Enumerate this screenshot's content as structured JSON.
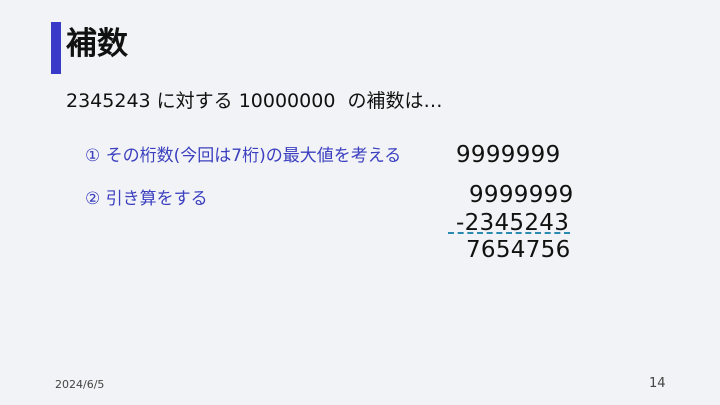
{
  "slide": {
    "title": "補数",
    "lead": "2345243 に対する 10000000  の補数は…",
    "steps": [
      "① その桁数(今回は7桁)の最大値を考える",
      "② 引き算をする"
    ],
    "max_value": "9999999",
    "subtraction": {
      "minuend": "9999999",
      "subtrahend": "-2345243",
      "result": "7654756"
    },
    "date": "2024/6/5",
    "page_number": "14",
    "colors": {
      "accent": "#3a3ac8",
      "step_text": "#3b3fbf",
      "underline": "#2a8ab0"
    }
  }
}
